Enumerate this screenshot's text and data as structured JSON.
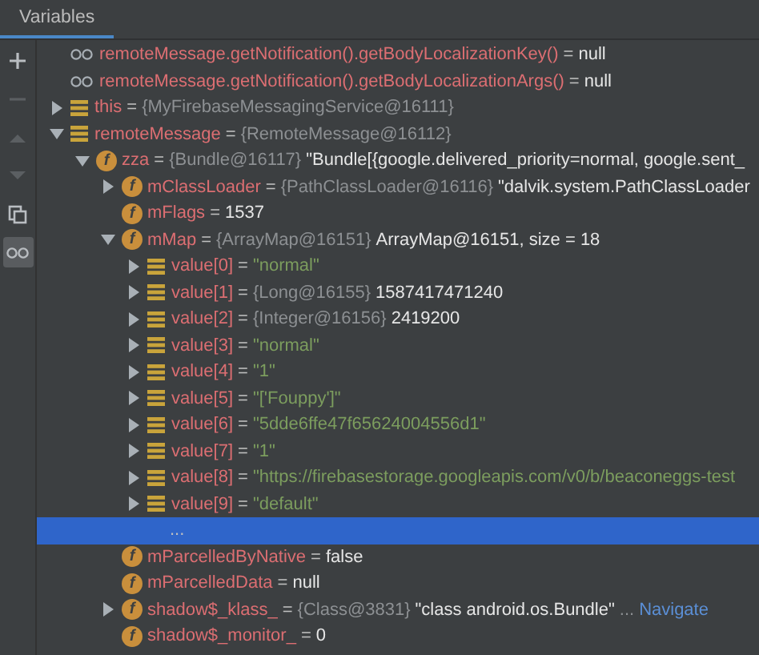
{
  "tab": {
    "label": "Variables",
    "selected": true
  },
  "toolbar": [
    {
      "kind": "add",
      "disabled": false
    },
    {
      "kind": "remove",
      "disabled": true
    },
    {
      "kind": "up",
      "disabled": true
    },
    {
      "kind": "down",
      "disabled": true
    },
    {
      "kind": "copy",
      "disabled": false
    },
    {
      "kind": "watches",
      "disabled": false,
      "selected": true
    }
  ],
  "tree": [
    {
      "kind": "watch",
      "name": "remoteMessage.getNotification().getBodyLocalizationKey()",
      "sep": "=",
      "value": "null",
      "is_string": false,
      "selected": false
    },
    {
      "kind": "watch",
      "name": "remoteMessage.getNotification().getBodyLocalizationArgs()",
      "sep": "=",
      "value": "null",
      "is_string": false,
      "selected": false
    },
    {
      "kind": "local",
      "name": "this",
      "sep": "=",
      "type": "{MyFirebaseMessagingService@16111}",
      "expanded": false,
      "selected": false
    },
    {
      "kind": "local",
      "name": "remoteMessage",
      "sep": "=",
      "type": "{RemoteMessage@16112}",
      "expanded": true,
      "selected": false,
      "children": [
        {
          "kind": "field",
          "badge": "f",
          "name": "zza",
          "sep": "=",
          "type": "{Bundle@16117}",
          "value": "\"Bundle[{google.delivered_priority=normal, google.sent_",
          "is_string": false,
          "expanded": true,
          "selected": false,
          "children": [
            {
              "kind": "field",
              "badge": "f",
              "name": "mClassLoader",
              "sep": "=",
              "type": "{PathClassLoader@16116}",
              "value": "\"dalvik.system.PathClassLoader",
              "is_string": false,
              "expanded": false,
              "selected": false
            },
            {
              "kind": "field",
              "badge": "f",
              "name": "mFlags",
              "sep": "=",
              "value": "1537",
              "is_string": false,
              "selected": false
            },
            {
              "kind": "field",
              "badge": "f",
              "name": "mMap",
              "sep": "=",
              "type": "{ArrayMap@16151}",
              "value": "ArrayMap@16151, size = 18",
              "is_string": false,
              "expanded": true,
              "selected": false,
              "children": [
                {
                  "kind": "local",
                  "name": "value[0]",
                  "sep": "=",
                  "value": "\"normal\"",
                  "is_string": true,
                  "expanded": false,
                  "selected": false
                },
                {
                  "kind": "local",
                  "name": "value[1]",
                  "sep": "=",
                  "type": "{Long@16155}",
                  "value": "1587417471240",
                  "is_string": false,
                  "expanded": false,
                  "selected": false
                },
                {
                  "kind": "local",
                  "name": "value[2]",
                  "sep": "=",
                  "type": "{Integer@16156}",
                  "value": "2419200",
                  "is_string": false,
                  "expanded": false,
                  "selected": false
                },
                {
                  "kind": "local",
                  "name": "value[3]",
                  "sep": "=",
                  "value": "\"normal\"",
                  "is_string": true,
                  "expanded": false,
                  "selected": false
                },
                {
                  "kind": "local",
                  "name": "value[4]",
                  "sep": "=",
                  "value": "\"1\"",
                  "is_string": true,
                  "expanded": false,
                  "selected": false
                },
                {
                  "kind": "local",
                  "name": "value[5]",
                  "sep": "=",
                  "value": "\"['Fouppy']\"",
                  "is_string": true,
                  "expanded": false,
                  "selected": false
                },
                {
                  "kind": "local",
                  "name": "value[6]",
                  "sep": "=",
                  "value": "\"5dde6ffe47f65624004556d1\"",
                  "is_string": true,
                  "expanded": false,
                  "selected": false
                },
                {
                  "kind": "local",
                  "name": "value[7]",
                  "sep": "=",
                  "value": "\"1\"",
                  "is_string": true,
                  "expanded": false,
                  "selected": false
                },
                {
                  "kind": "local",
                  "name": "value[8]",
                  "sep": "=",
                  "value": "\"https://firebasestorage.googleapis.com/v0/b/beaconeggs-test",
                  "is_string": true,
                  "expanded": false,
                  "selected": false
                },
                {
                  "kind": "local",
                  "name": "value[9]",
                  "sep": "=",
                  "value": "\"default\"",
                  "is_string": true,
                  "expanded": false,
                  "selected": false
                },
                {
                  "kind": "more",
                  "name": "...",
                  "selected": true
                }
              ]
            },
            {
              "kind": "field",
              "badge": "f",
              "name": "mParcelledByNative",
              "sep": "=",
              "value": "false",
              "is_string": false,
              "selected": false
            },
            {
              "kind": "field",
              "badge": "f",
              "name": "mParcelledData",
              "sep": "=",
              "value": "null",
              "is_string": false,
              "selected": false
            },
            {
              "kind": "field",
              "badge": "f",
              "name": "shadow$_klass_",
              "sep": "=",
              "type": "{Class@3831}",
              "value": "\"class android.os.Bundle\"",
              "is_string": false,
              "ellipsis": "...",
              "link": "Navigate",
              "expanded": false,
              "selected": false
            },
            {
              "kind": "field",
              "badge": "f",
              "name": "shadow$_monitor_",
              "sep": "=",
              "value": "0",
              "is_string": false,
              "selected": false
            }
          ]
        }
      ]
    }
  ]
}
